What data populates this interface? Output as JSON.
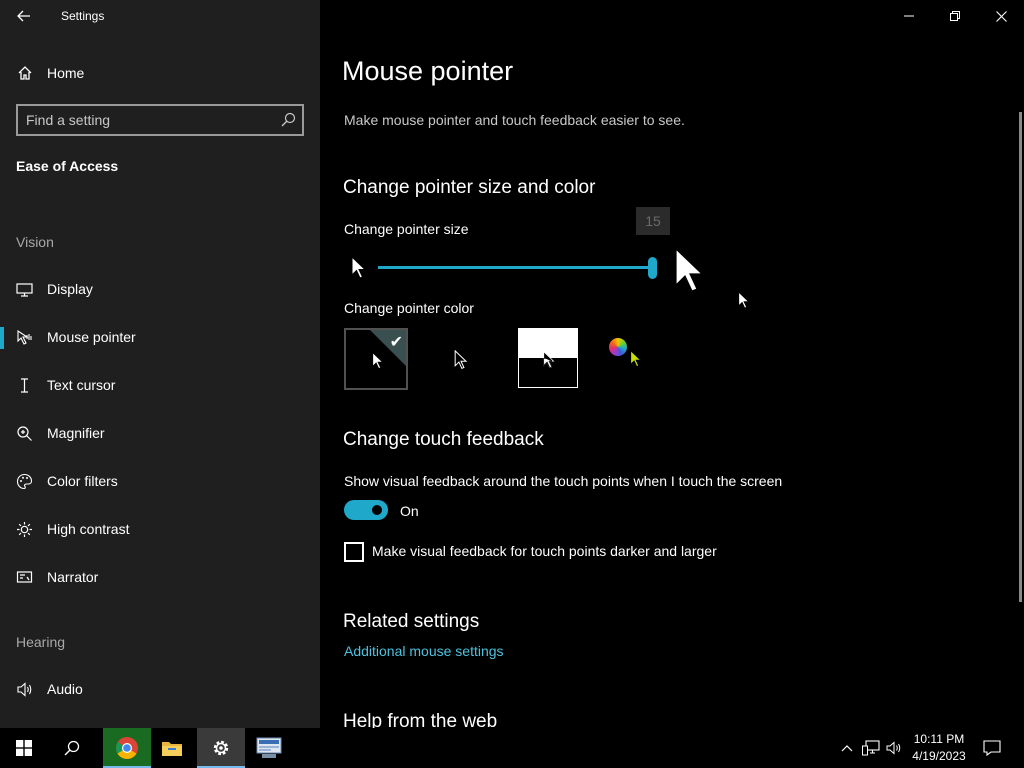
{
  "window": {
    "title": "Settings"
  },
  "sidebar": {
    "home_label": "Home",
    "search_placeholder": "Find a setting",
    "section_title": "Ease of Access",
    "groups": {
      "vision": "Vision",
      "hearing": "Hearing"
    },
    "items": [
      {
        "label": "Display",
        "icon": "display-icon"
      },
      {
        "label": "Mouse pointer",
        "icon": "mouse-pointer-icon",
        "selected": true
      },
      {
        "label": "Text cursor",
        "icon": "text-cursor-icon"
      },
      {
        "label": "Magnifier",
        "icon": "magnifier-icon"
      },
      {
        "label": "Color filters",
        "icon": "color-filters-icon"
      },
      {
        "label": "High contrast",
        "icon": "high-contrast-icon"
      },
      {
        "label": "Narrator",
        "icon": "narrator-icon"
      },
      {
        "label": "Audio",
        "icon": "audio-icon"
      }
    ]
  },
  "main": {
    "title": "Mouse pointer",
    "description": "Make mouse pointer and touch feedback easier to see.",
    "pointer_section": {
      "heading": "Change pointer size and color",
      "size_label": "Change pointer size",
      "size_value": "15",
      "color_label": "Change pointer color",
      "color_options": [
        "white",
        "black",
        "inverted",
        "custom"
      ],
      "selected_color": "white"
    },
    "touch_section": {
      "heading": "Change touch feedback",
      "toggle_label": "Show visual feedback around the touch points when I touch the screen",
      "toggle_state": "On",
      "checkbox_label": "Make visual feedback for touch points darker and larger",
      "checkbox_checked": false
    },
    "related": {
      "heading": "Related settings",
      "link": "Additional mouse settings"
    },
    "help": {
      "heading": "Help from the web"
    }
  },
  "taskbar": {
    "apps": [
      "start",
      "search",
      "chrome",
      "file-explorer",
      "settings",
      "network-tool"
    ],
    "active_app": "settings",
    "time": "10:11 PM",
    "date": "4/19/2023"
  },
  "colors": {
    "accent": "#1fa8c9",
    "link": "#4cc2e0",
    "sidebar_bg": "#1f1f1f",
    "main_bg": "#000000"
  }
}
